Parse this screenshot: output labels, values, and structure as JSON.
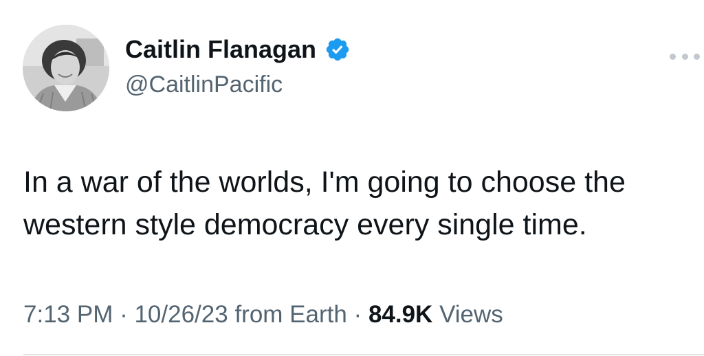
{
  "author": {
    "display_name": "Caitlin Flanagan",
    "handle": "@CaitlinPacific",
    "verified": true,
    "avatar_icon": "profile-photo-icon"
  },
  "tweet": {
    "text_lines": [
      "In a war of the worlds, I'm going to choose the",
      "western style democracy every single time."
    ]
  },
  "meta": {
    "time": "7:13 PM",
    "sep1": " · ",
    "date": "10/26/23",
    "source": " from Earth",
    "sep2": " · ",
    "views_count": "84.9K",
    "views_label": " Views"
  },
  "colors": {
    "text": "#0f1419",
    "secondary": "#536471",
    "verified_badge": "#1d9bf0",
    "more_dots": "#c2c8ce",
    "divider": "#dfe3e6"
  }
}
